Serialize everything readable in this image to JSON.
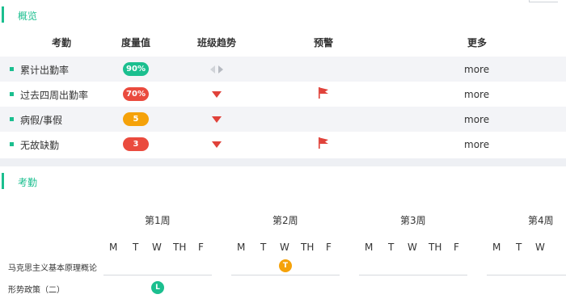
{
  "overview": {
    "title": "概览",
    "headers": {
      "item": "考勤",
      "metric": "度量值",
      "trend": "班级趋势",
      "alert": "预警",
      "more": "更多"
    },
    "rows": [
      {
        "name": "累计出勤率",
        "value": "90%",
        "color": "#1bbf8f",
        "trend": "neutral-icon",
        "alert": false,
        "more": "more"
      },
      {
        "name": "过去四周出勤率",
        "value": "70%",
        "color": "#ea4b3e",
        "trend": "down-triangle-icon",
        "alert": true,
        "more": "more"
      },
      {
        "name": "病假/事假",
        "value": "5",
        "color": "#f5a20a",
        "trend": "down-triangle-icon",
        "alert": false,
        "more": "more"
      },
      {
        "name": "无故缺勤",
        "value": "3",
        "color": "#ea4b3e",
        "trend": "down-triangle-icon",
        "alert": true,
        "more": "more"
      }
    ]
  },
  "attendance": {
    "title": "考勤",
    "weeks": [
      "第1周",
      "第2周",
      "第3周",
      "第4周"
    ],
    "days": [
      "M",
      "T",
      "W",
      "TH",
      "F"
    ],
    "courses": [
      {
        "name": "马克思主义基本原理概论",
        "mark": "T",
        "mark_color": "#f5a20a",
        "week": "第2周",
        "day": "W"
      },
      {
        "name": "形势政策（二）",
        "mark": "L",
        "mark_color": "#1bbf8f",
        "week": "第1周",
        "day": "W"
      }
    ]
  }
}
